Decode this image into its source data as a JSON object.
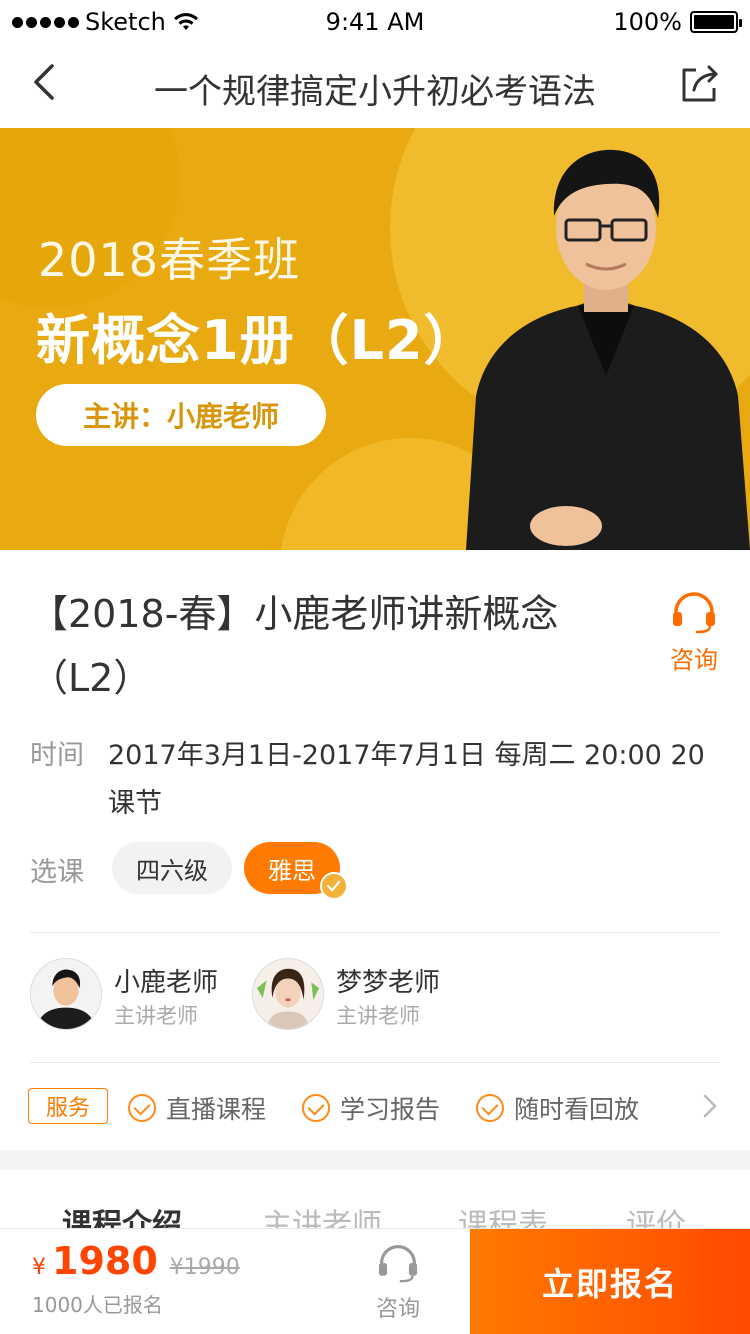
{
  "status_bar": {
    "carrier": "Sketch",
    "time": "9:41 AM",
    "battery": "100%"
  },
  "nav": {
    "title": "一个规律搞定小升初必考语法"
  },
  "banner": {
    "season": "2018春季班",
    "course_name": "新概念1册（L2）",
    "teacher": "主讲：小鹿老师"
  },
  "course": {
    "title": "【2018-春】小鹿老师讲新概念（L2）",
    "consult_label": "咨询",
    "time_label": "时间",
    "time_value": "2017年3月1日-2017年7月1日 每周二 20:00 20课节",
    "select_label": "选课",
    "options": [
      "四六级",
      "雅思"
    ],
    "selected_option": "雅思"
  },
  "teachers": [
    {
      "name": "小鹿老师",
      "role": "主讲老师"
    },
    {
      "name": "梦梦老师",
      "role": "主讲老师"
    }
  ],
  "services": {
    "tag": "服务",
    "items": [
      "直播课程",
      "学习报告",
      "随时看回放"
    ]
  },
  "tabs": [
    "课程介绍",
    "主讲老师",
    "课程表",
    "评价"
  ],
  "bottom": {
    "currency": "¥",
    "price": "1980",
    "old_price": "¥1990",
    "enrolled": "1000人已报名",
    "consult_label": "咨询",
    "signup_label": "立即报名"
  },
  "colors": {
    "accent": "#ff7a00",
    "price": "#ff4500",
    "banner": "#e8aa10"
  }
}
